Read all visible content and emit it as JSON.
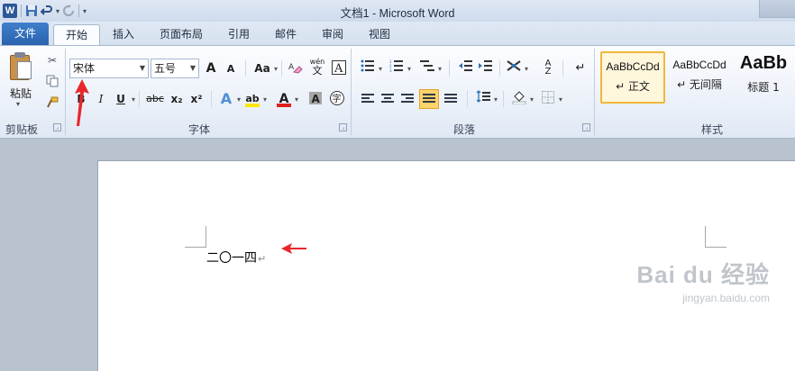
{
  "window": {
    "title": "文档1 - Microsoft Word"
  },
  "quick_access": {
    "app_icon": "W",
    "save_icon": "save-icon",
    "undo_icon": "undo-icon",
    "redo_icon": "redo-icon",
    "customize_icon": "customize-qat-icon"
  },
  "tabs": [
    {
      "label": "文件"
    },
    {
      "label": "开始"
    },
    {
      "label": "插入"
    },
    {
      "label": "页面布局"
    },
    {
      "label": "引用"
    },
    {
      "label": "邮件"
    },
    {
      "label": "审阅"
    },
    {
      "label": "视图"
    }
  ],
  "clipboard": {
    "paste_label": "粘贴",
    "group_label": "剪贴板"
  },
  "font": {
    "font_name": "宋体",
    "font_size": "五号",
    "grow_glyph": "A",
    "shrink_glyph": "A",
    "change_case_glyph": "Aa",
    "pinyin_glyph": "wén",
    "bold_glyph": "B",
    "italic_glyph": "I",
    "underline_glyph": "U",
    "strike_glyph": "abc",
    "subscript_glyph": "x₂",
    "superscript_glyph": "x²",
    "text_effect_glyph": "A",
    "highlight_glyph": "ab",
    "font_color_glyph": "A",
    "shading_glyph": "A",
    "enclose_glyph": "字",
    "group_label": "字体"
  },
  "paragraph": {
    "group_label": "段落"
  },
  "styles": {
    "items": [
      {
        "sample": "AaBbCcDd",
        "name": "↵ 正文"
      },
      {
        "sample": "AaBbCcDd",
        "name": "↵ 无间隔"
      },
      {
        "sample": "AaBb",
        "name": "标题 1"
      }
    ],
    "group_label": "样式"
  },
  "document": {
    "text": "二〇一四",
    "paragraph_mark": "↵"
  },
  "watermark": {
    "main": "Bai du 经验",
    "sub": "jingyan.baidu.com"
  },
  "colors": {
    "file_tab": "#2a62ae",
    "highlight_yellow": "#ffd46b",
    "font_color_red": "#e02020",
    "annotation_red": "#e8262b"
  }
}
